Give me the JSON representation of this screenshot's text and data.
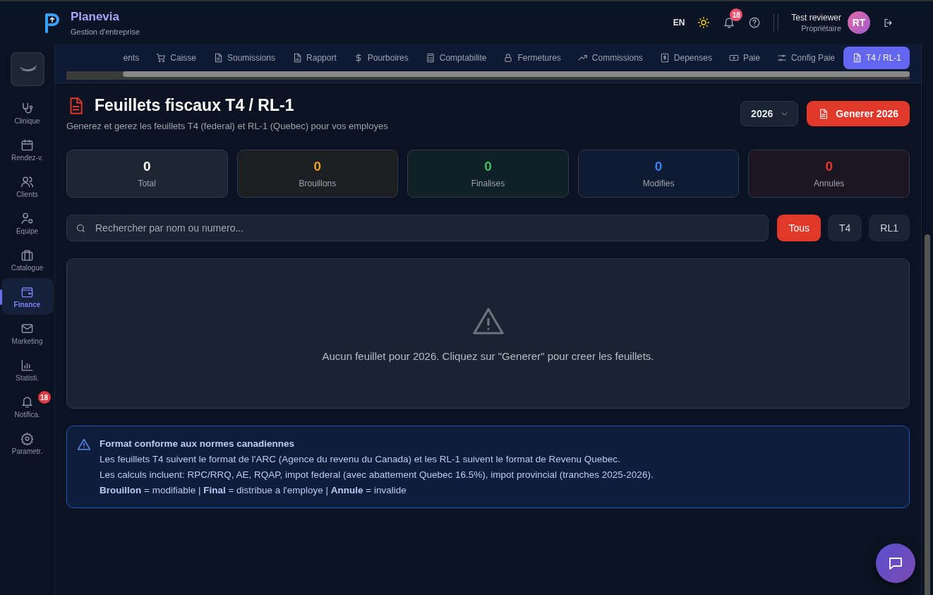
{
  "header": {
    "app_name": "Planevia",
    "subtitle": "Gestion d'entreprise",
    "language": "EN",
    "notifications_badge": "18",
    "user_name": "Test reviewer",
    "user_role": "Propriétaire",
    "avatar_initials": "RT"
  },
  "sidebar": {
    "items": [
      {
        "label": "Clinique",
        "selected": false
      },
      {
        "label": "Rendez-v.",
        "selected": false
      },
      {
        "label": "Clients",
        "selected": false
      },
      {
        "label": "Equipe",
        "selected": false
      },
      {
        "label": "Catalogue",
        "selected": false
      },
      {
        "label": "Finance",
        "selected": true
      },
      {
        "label": "Marketing",
        "selected": false
      },
      {
        "label": "Statisti.",
        "selected": false
      },
      {
        "label": "Notifica.",
        "selected": false,
        "badge": "18"
      },
      {
        "label": "Parametr.",
        "selected": false
      }
    ]
  },
  "tabs": [
    {
      "label": "ents",
      "selected": false
    },
    {
      "label": "Caisse",
      "selected": false
    },
    {
      "label": "Soumissions",
      "selected": false
    },
    {
      "label": "Rapport",
      "selected": false
    },
    {
      "label": "Pourboires",
      "selected": false
    },
    {
      "label": "Comptabilite",
      "selected": false
    },
    {
      "label": "Fermetures",
      "selected": false
    },
    {
      "label": "Commissions",
      "selected": false
    },
    {
      "label": "Depenses",
      "selected": false
    },
    {
      "label": "Paie",
      "selected": false
    },
    {
      "label": "Config Paie",
      "selected": false
    },
    {
      "label": "T4 / RL-1",
      "selected": true
    }
  ],
  "page": {
    "title": "Feuillets fiscaux T4 / RL-1",
    "description": "Generez et gerez les feuillets T4 (federal) et RL-1 (Quebec) pour vos employes",
    "year": "2026",
    "generate_button": "Generer 2026"
  },
  "stats": [
    {
      "value": "0",
      "label": "Total",
      "color": "#ffffff"
    },
    {
      "value": "0",
      "label": "Brouillons",
      "color": "#e0a02a"
    },
    {
      "value": "0",
      "label": "Finalises",
      "color": "#3fbf63"
    },
    {
      "value": "0",
      "label": "Modifies",
      "color": "#3b82f6"
    },
    {
      "value": "0",
      "label": "Annules",
      "color": "#e0392b"
    }
  ],
  "search": {
    "placeholder": "Rechercher par nom ou numero..."
  },
  "filters": [
    {
      "label": "Tous",
      "selected": true
    },
    {
      "label": "T4",
      "selected": false
    },
    {
      "label": "RL1",
      "selected": false
    }
  ],
  "empty_state": {
    "message": "Aucun feuillet pour 2026. Cliquez sur \"Generer\" pour creer les feuillets."
  },
  "info": {
    "title": "Format conforme aux normes canadiennes",
    "lines": [
      "Les feuillets T4 suivent le format de l'ARC (Agence du revenu du Canada) et les RL-1 suivent le format de Revenu Quebec.",
      "Les calculs incluent: RPC/RRQ, AE, RQAP, impot federal (avec abattement Quebec 16.5%), impot provincial (tranches 2025-2026).",
      "**Brouillon** = modifiable | **Final** = distribue a l'employe | **Annule** = invalide"
    ]
  }
}
